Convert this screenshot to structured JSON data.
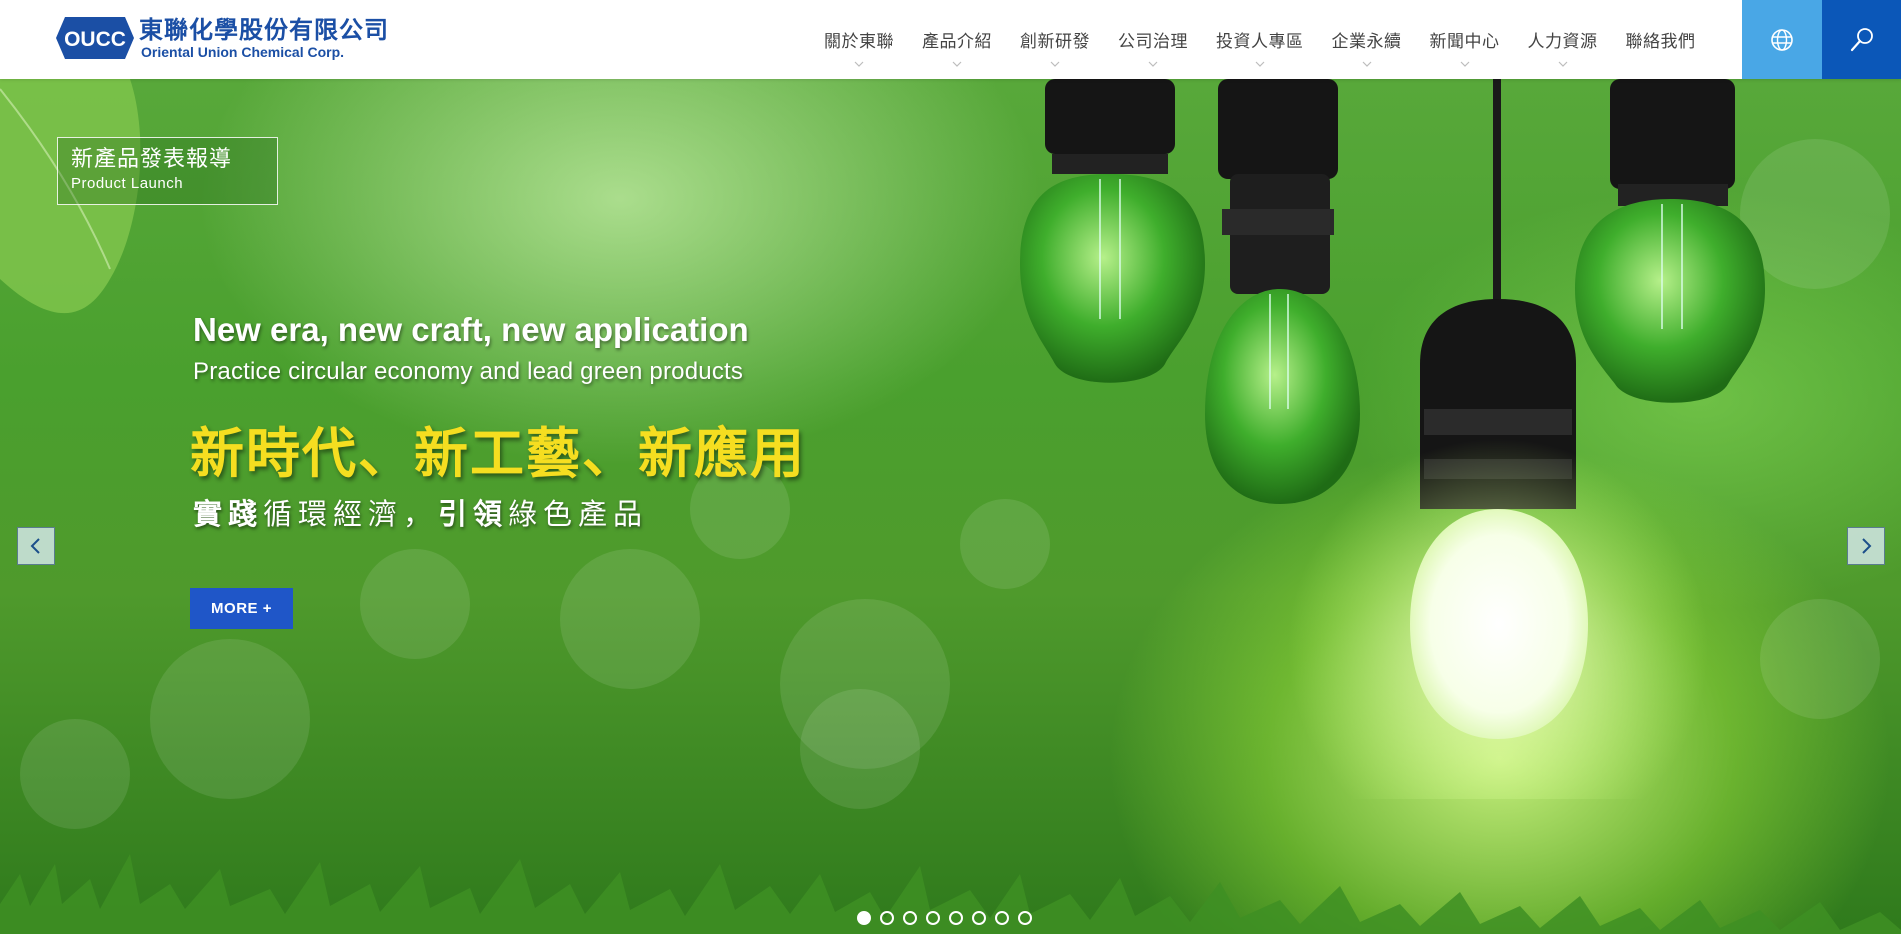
{
  "brand": {
    "logo_abbr": "OUCC",
    "name_cn": "東聯化學股份有限公司",
    "name_en": "Oriental Union Chemical Corp.",
    "color": "#1b4fa5"
  },
  "nav": {
    "items": [
      {
        "label": "關於東聯",
        "has_submenu": true
      },
      {
        "label": "產品介紹",
        "has_submenu": true
      },
      {
        "label": "創新研發",
        "has_submenu": true
      },
      {
        "label": "公司治理",
        "has_submenu": true
      },
      {
        "label": "投資人專區",
        "has_submenu": true
      },
      {
        "label": "企業永續",
        "has_submenu": true
      },
      {
        "label": "新聞中心",
        "has_submenu": true
      },
      {
        "label": "人力資源",
        "has_submenu": true
      },
      {
        "label": "聯絡我們",
        "has_submenu": false
      }
    ],
    "globe_icon": "globe-icon",
    "search_icon": "search-icon",
    "globe_color": "#49a7e6",
    "search_color": "#0b57b8"
  },
  "hero": {
    "badge_cn": "新產品發表報導",
    "badge_en": "Product Launch",
    "headline_en": "New era, new craft, new application",
    "subline_en": "Practice circular economy and lead green products",
    "headline_cn": "新時代、新工藝、新應用",
    "subline_cn_parts": [
      "實踐",
      "循環經濟，",
      "引領",
      "綠色產品"
    ],
    "headline_cn_color": "#f5de20",
    "more_label": "MORE +",
    "more_color": "#1f56c8",
    "prev_icon": "chevron-left-icon",
    "next_icon": "chevron-right-icon",
    "slide_count": 8,
    "active_slide": 1
  }
}
